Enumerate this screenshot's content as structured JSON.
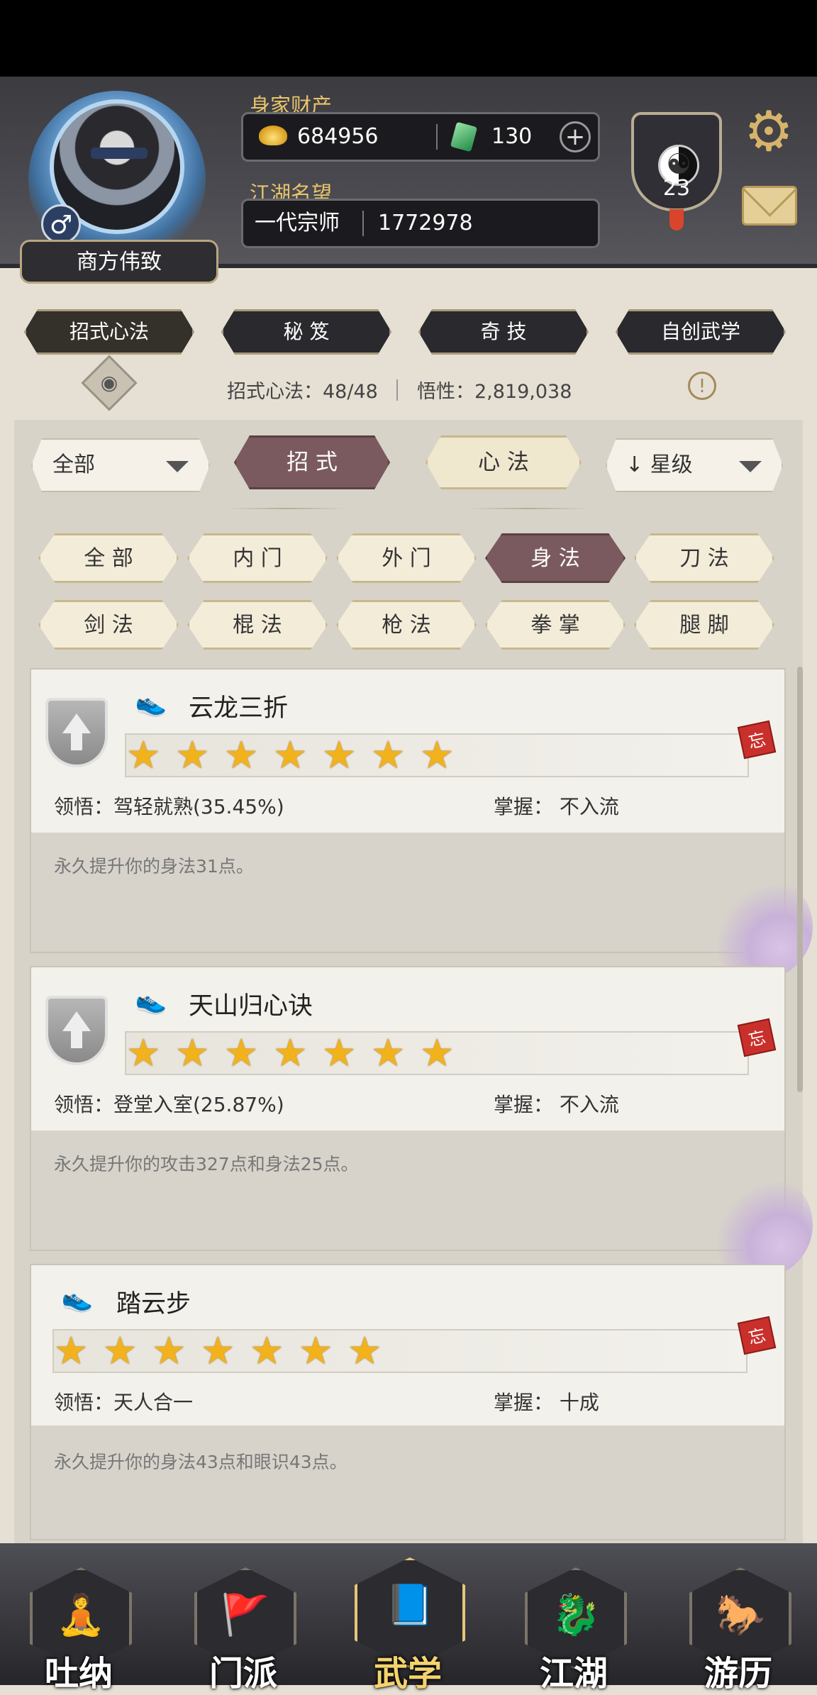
{
  "player": {
    "name": "商方伟致",
    "gender_icon": "♂",
    "wealth_label": "身家财产",
    "gold": "684956",
    "jade": "130",
    "reputation_label": "江湖名望",
    "title": "一代宗师",
    "reputation": "1772978",
    "level": "23"
  },
  "tabs": [
    {
      "label": "招式心法",
      "active": true
    },
    {
      "label": "秘 笈",
      "active": false
    },
    {
      "label": "奇 技",
      "active": false
    },
    {
      "label": "自创武学",
      "active": false
    }
  ],
  "stats": {
    "skills": "招式心法：48/48",
    "insight": "悟性：2,819,038"
  },
  "filters": {
    "category_select": "全部",
    "segment_left": "招 式",
    "segment_right": "心 法",
    "sort_select": "星级",
    "sort_arrow": "↓",
    "types": [
      "全 部",
      "内 门",
      "外 门",
      "身 法",
      "刀 法",
      "剑 法",
      "棍 法",
      "枪 法",
      "拳 掌",
      "腿 脚"
    ],
    "active_type": "身 法"
  },
  "skills": [
    {
      "name": "云龙三折",
      "stars": 7,
      "comprehension": "领悟：驾轻就熟(35.45%)",
      "mastery": "掌握：  不入流",
      "desc": "永久提升你的身法31点。",
      "tag": "忘"
    },
    {
      "name": "天山归心诀",
      "stars": 7,
      "comprehension": "领悟：登堂入室(25.87%)",
      "mastery": "掌握：  不入流",
      "desc": "永久提升你的攻击327点和身法25点。",
      "tag": "忘"
    },
    {
      "name": "踏云步",
      "stars": 7,
      "comprehension": "领悟：天人合一",
      "mastery": "掌握：  十成",
      "desc": "永久提升你的身法43点和眼识43点。",
      "tag": "忘"
    }
  ],
  "nav": [
    {
      "label": "吐纳",
      "icon": "🧘",
      "active": false
    },
    {
      "label": "门派",
      "icon": "🚩",
      "active": false
    },
    {
      "label": "武学",
      "icon": "📘",
      "active": true
    },
    {
      "label": "江湖",
      "icon": "🐉",
      "active": false
    },
    {
      "label": "游历",
      "icon": "🐎",
      "active": false
    }
  ],
  "colors": {
    "accent_active": "#7a5a5f",
    "gold_text": "#e9c46a",
    "star": "#f2b21c"
  }
}
